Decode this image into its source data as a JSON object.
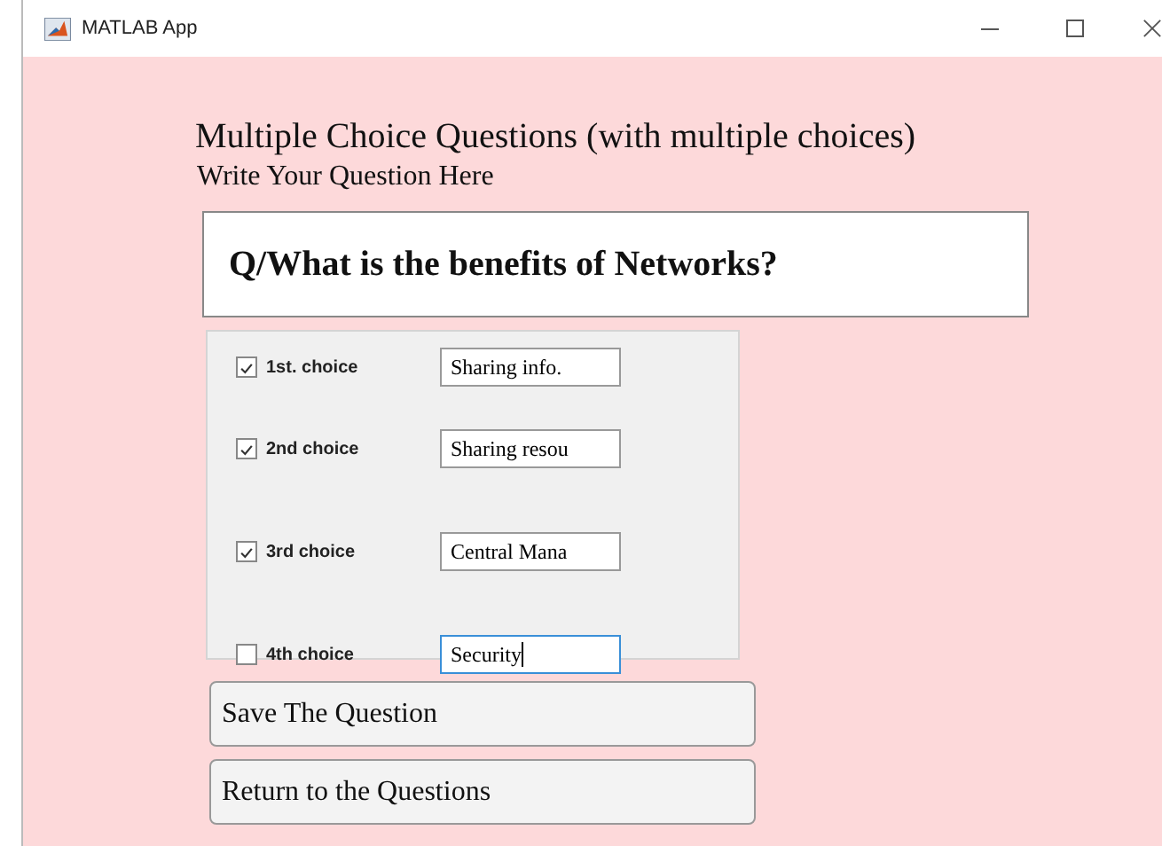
{
  "window": {
    "title": "MATLAB App"
  },
  "heading": "Multiple Choice Questions (with multiple choices)",
  "subheading": "Write Your Question Here",
  "question": "Q/What is the benefits of Networks?",
  "choices": [
    {
      "label": "1st. choice",
      "checked": true,
      "value": "Sharing info.",
      "focused": false
    },
    {
      "label": "2nd choice",
      "checked": true,
      "value": "Sharing resou",
      "focused": false
    },
    {
      "label": "3rd choice",
      "checked": true,
      "value": "Central Mana",
      "focused": false
    },
    {
      "label": "4th choice",
      "checked": false,
      "value": "Security",
      "focused": true
    }
  ],
  "buttons": [
    "Save The Question",
    "Return to the Questions"
  ]
}
